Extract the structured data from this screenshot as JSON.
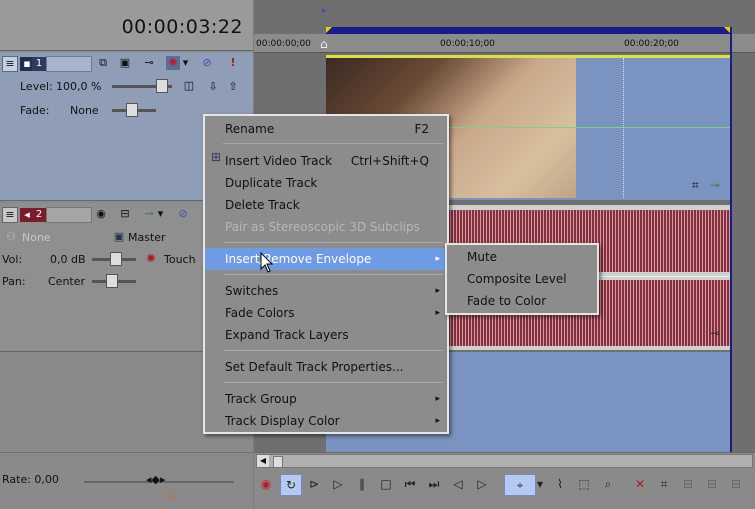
{
  "header": {
    "timecode": "00:00:03:22"
  },
  "ruler": {
    "marks": [
      "00:00:00;00",
      "00:00:10;00",
      "00:00:20;00"
    ]
  },
  "track1": {
    "number": "1",
    "level_label": "Level:",
    "level_value": "100,0 %",
    "fade_label": "Fade:",
    "fade_value": "None"
  },
  "track2": {
    "number": "2",
    "none_label": "None",
    "master_label": "Master",
    "vol_label": "Vol:",
    "vol_value": "0,0 dB",
    "touch_label": "Touch",
    "pan_label": "Pan:",
    "pan_value": "Center"
  },
  "rate": {
    "label": "Rate: 0,00"
  },
  "context_menu": {
    "items": [
      {
        "label": "Rename",
        "shortcut": "F2"
      },
      {
        "label": "Insert Video Track",
        "shortcut": "Ctrl+Shift+Q"
      },
      {
        "label": "Duplicate Track"
      },
      {
        "label": "Delete Track"
      },
      {
        "label": "Pair as Stereoscopic 3D Subclips",
        "disabled": true
      },
      {
        "label": "Insert/Remove Envelope",
        "submenu": true,
        "selected": true
      },
      {
        "label": "Switches",
        "submenu": true
      },
      {
        "label": "Fade Colors",
        "submenu": true
      },
      {
        "label": "Expand Track Layers"
      },
      {
        "label": "Set Default Track Properties..."
      },
      {
        "label": "Track Group",
        "submenu": true
      },
      {
        "label": "Track Display Color",
        "submenu": true
      }
    ]
  },
  "submenu": {
    "items": [
      "Mute",
      "Composite Level",
      "Fade to Color"
    ]
  },
  "icons": {
    "submenu_arrow": "▸"
  }
}
